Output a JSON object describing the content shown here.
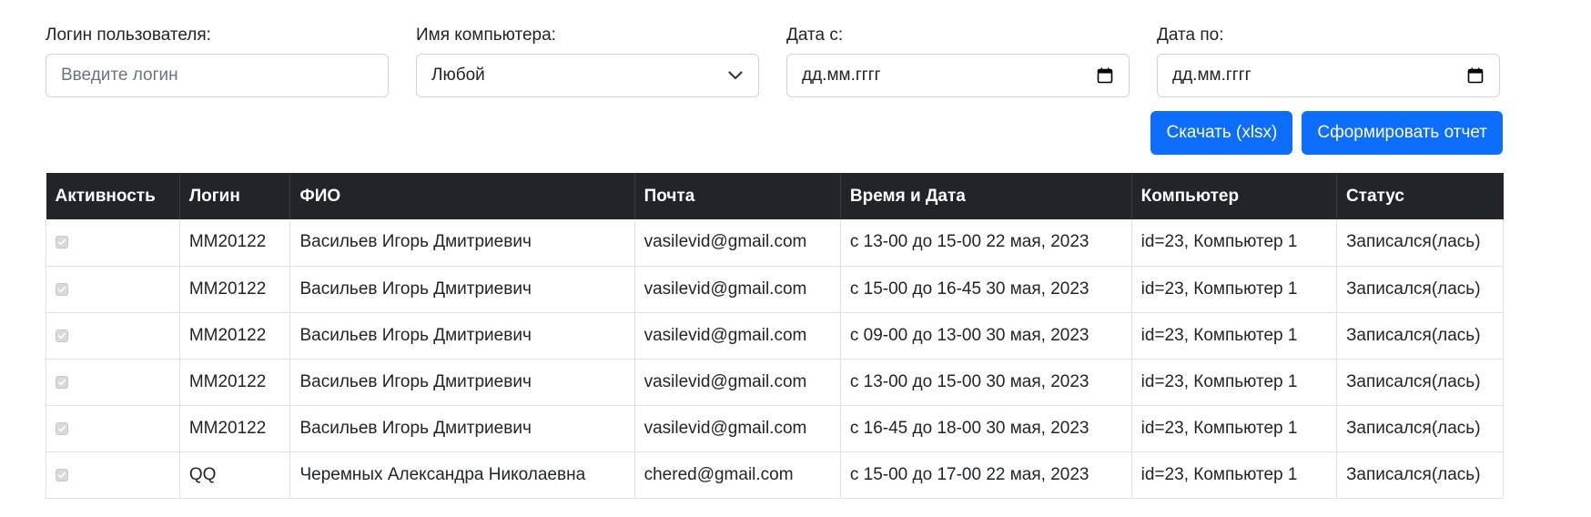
{
  "filters": {
    "login": {
      "label": "Логин пользователя:",
      "placeholder": "Введите логин"
    },
    "computer": {
      "label": "Имя компьютера:",
      "value": "Любой"
    },
    "date_from": {
      "label": "Дата с:",
      "value": "дд.мм.гггг"
    },
    "date_to": {
      "label": "Дата по:",
      "value": "дд.мм.гггг"
    }
  },
  "buttons": {
    "download": "Скачать (xlsx)",
    "report": "Сформировать отчет"
  },
  "table": {
    "headers": [
      "Активность",
      "Логин",
      "ФИО",
      "Почта",
      "Время и Дата",
      "Компьютер",
      "Статус"
    ],
    "rows": [
      {
        "active": true,
        "login": "MM20122",
        "name": "Васильев Игорь Дмитриевич",
        "email": "vasilevid@gmail.com",
        "time": "с 13-00 до 15-00 22 мая, 2023",
        "computer": "id=23, Компьютер 1",
        "status": "Записался(лась)"
      },
      {
        "active": true,
        "login": "MM20122",
        "name": "Васильев Игорь Дмитриевич",
        "email": "vasilevid@gmail.com",
        "time": "с 15-00 до 16-45 30 мая, 2023",
        "computer": "id=23, Компьютер 1",
        "status": "Записался(лась)"
      },
      {
        "active": true,
        "login": "MM20122",
        "name": "Васильев Игорь Дмитриевич",
        "email": "vasilevid@gmail.com",
        "time": "с 09-00 до 13-00 30 мая, 2023",
        "computer": "id=23, Компьютер 1",
        "status": "Записался(лась)"
      },
      {
        "active": true,
        "login": "MM20122",
        "name": "Васильев Игорь Дмитриевич",
        "email": "vasilevid@gmail.com",
        "time": "с 13-00 до 15-00 30 мая, 2023",
        "computer": "id=23, Компьютер 1",
        "status": "Записался(лась)"
      },
      {
        "active": true,
        "login": "MM20122",
        "name": "Васильев Игорь Дмитриевич",
        "email": "vasilevid@gmail.com",
        "time": "с 16-45 до 18-00 30 мая, 2023",
        "computer": "id=23, Компьютер 1",
        "status": "Записался(лась)"
      },
      {
        "active": true,
        "login": "QQ",
        "name": "Черемных Александра Николаевна",
        "email": "chered@gmail.com",
        "time": "с 15-00 до 17-00 22 мая, 2023",
        "computer": "id=23, Компьютер 1",
        "status": "Записался(лась)"
      }
    ]
  },
  "colors": {
    "primary": "#0d6efd",
    "header_bg": "#212529"
  }
}
